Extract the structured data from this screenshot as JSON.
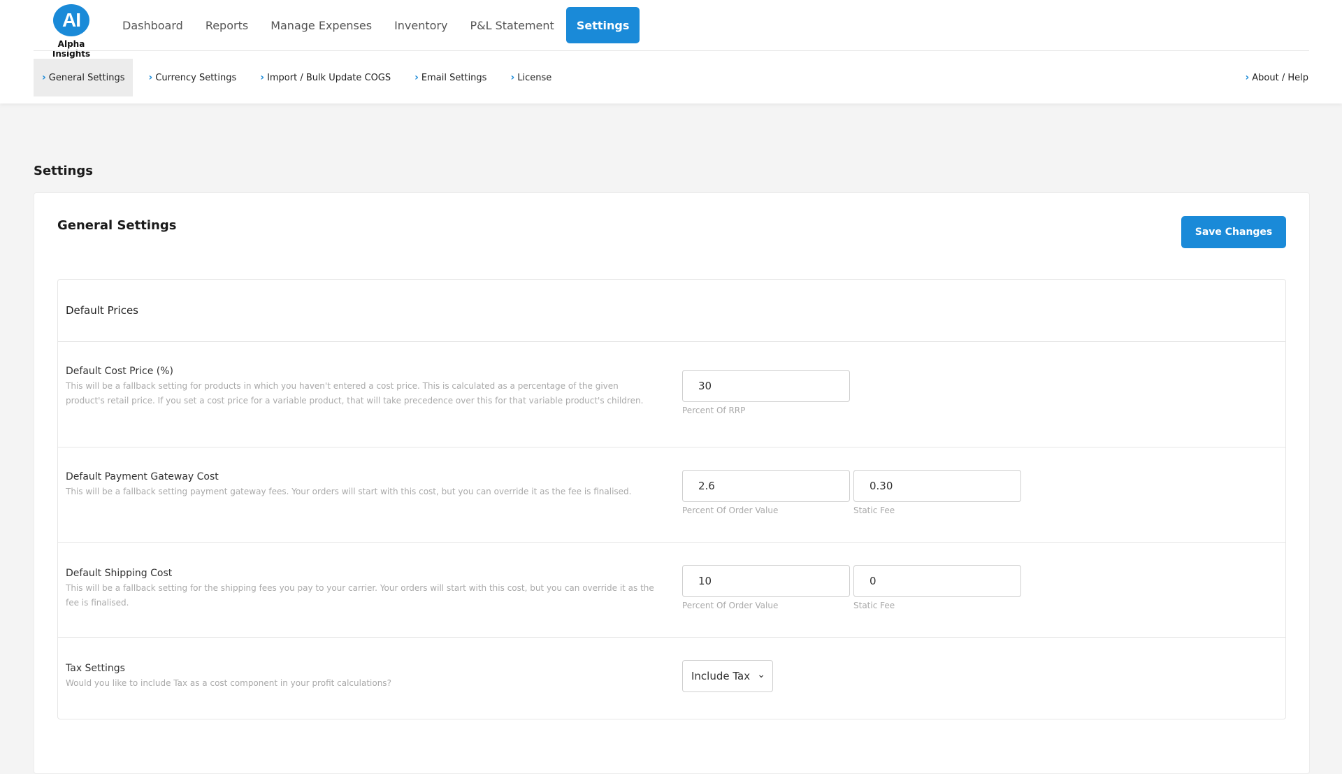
{
  "brand": {
    "logo_mark": "AI",
    "name": "Alpha Insights"
  },
  "main_nav": [
    {
      "label": "Dashboard",
      "active": false
    },
    {
      "label": "Reports",
      "active": false
    },
    {
      "label": "Manage Expenses",
      "active": false
    },
    {
      "label": "Inventory",
      "active": false
    },
    {
      "label": "P&L Statement",
      "active": false
    },
    {
      "label": "Settings",
      "active": true
    }
  ],
  "sub_nav": [
    {
      "label": "General Settings",
      "active": true
    },
    {
      "label": "Currency Settings",
      "active": false
    },
    {
      "label": "Import / Bulk Update COGS",
      "active": false
    },
    {
      "label": "Email Settings",
      "active": false
    },
    {
      "label": "License",
      "active": false
    }
  ],
  "sub_nav_right": {
    "label": "About / Help"
  },
  "page": {
    "heading": "Settings"
  },
  "card": {
    "title": "General Settings",
    "save_label": "Save Changes"
  },
  "section": {
    "title": "Default Prices",
    "rows": [
      {
        "title": "Default Cost Price (%)",
        "desc": "This will be a fallback setting for products in which you haven't entered a cost price. This is calculated as a percentage of the given product's retail price. If you set a cost price for a variable product, that will take precedence over this for that variable product's children.",
        "fields": [
          {
            "value": "30",
            "label": "Percent Of RRP"
          }
        ]
      },
      {
        "title": "Default Payment Gateway Cost",
        "desc": "This will be a fallback setting payment gateway fees. Your orders will start with this cost, but you can override it as the fee is finalised.",
        "fields": [
          {
            "value": "2.6",
            "label": "Percent Of Order Value"
          },
          {
            "value": "0.30",
            "label": "Static Fee"
          }
        ]
      },
      {
        "title": "Default Shipping Cost",
        "desc": "This will be a fallback setting for the shipping fees you pay to your carrier. Your orders will start with this cost, but you can override it as the fee is finalised.",
        "fields": [
          {
            "value": "10",
            "label": "Percent Of Order Value"
          },
          {
            "value": "0",
            "label": "Static Fee"
          }
        ]
      },
      {
        "title": "Tax Settings",
        "desc": "Would you like to include Tax as a cost component in your profit calculations?",
        "select_value": "Include Tax"
      }
    ]
  },
  "colors": {
    "accent": "#1a8ad8",
    "background": "#f4f4f4"
  }
}
